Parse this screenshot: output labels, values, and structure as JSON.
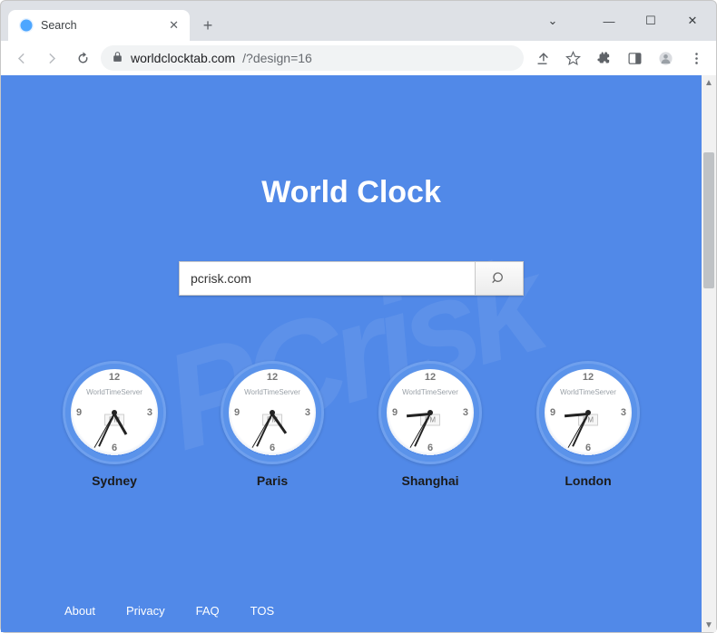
{
  "browser": {
    "tab_title": "Search",
    "url_host": "worldclocktab.com",
    "url_path": "/?design=16"
  },
  "page": {
    "heading": "World Clock",
    "search_value": "pcrisk.com",
    "search_placeholder": "",
    "clock_brand": "WorldTimeServer",
    "ampm": "PM",
    "clocks": [
      {
        "label": "Sydney"
      },
      {
        "label": "Paris"
      },
      {
        "label": "Shanghai"
      },
      {
        "label": "London"
      }
    ],
    "footer": {
      "about": "About",
      "privacy": "Privacy",
      "faq": "FAQ",
      "tos": "TOS"
    },
    "dials": {
      "d12": "12",
      "d3": "3",
      "d6": "6",
      "d9": "9"
    }
  }
}
